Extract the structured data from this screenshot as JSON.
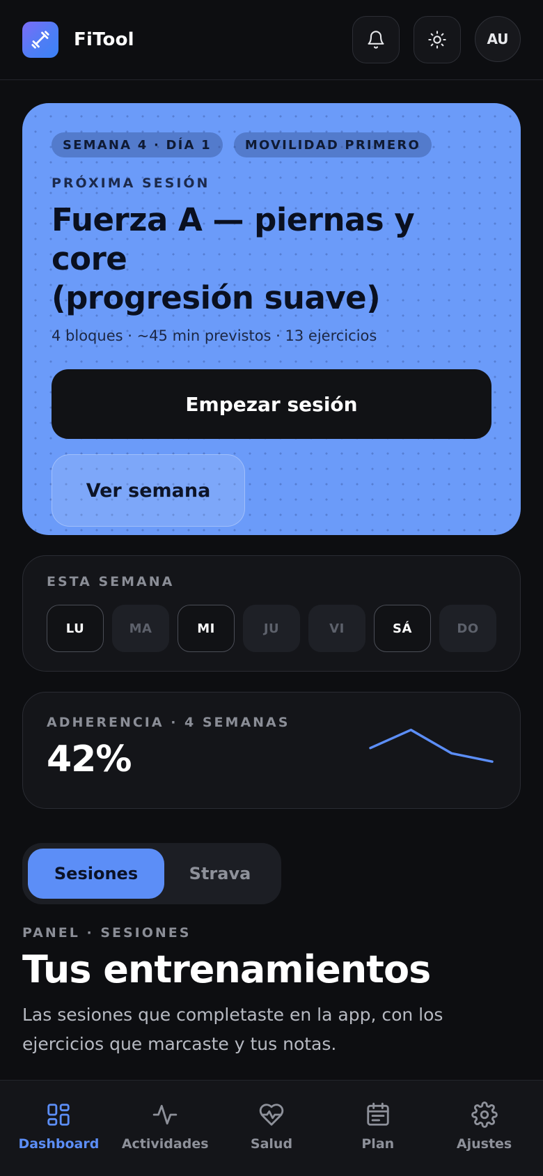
{
  "app": {
    "name": "FiTool"
  },
  "header": {
    "avatar_initials": "AU"
  },
  "hero": {
    "chips": [
      "SEMANA 4 · DÍA 1",
      "MOVILIDAD PRIMERO"
    ],
    "eyebrow": "PRÓXIMA SESIÓN",
    "title_line1": "Fuerza A — piernas y core",
    "title_line2": "(progresión suave)",
    "meta": "4 bloques · ~45 min previstos · 13 ejercicios",
    "primary_label": "Empezar sesión",
    "secondary_label": "Ver semana"
  },
  "week": {
    "label": "ESTA SEMANA",
    "days": [
      {
        "label": "LU",
        "active": true
      },
      {
        "label": "MA",
        "active": false
      },
      {
        "label": "MI",
        "active": true
      },
      {
        "label": "JU",
        "active": false
      },
      {
        "label": "VI",
        "active": false
      },
      {
        "label": "SÁ",
        "active": true
      },
      {
        "label": "DO",
        "active": false
      }
    ]
  },
  "adherence": {
    "label": "ADHERENCIA · 4 SEMANAS",
    "value": "42%",
    "trend": [
      48,
      72,
      41,
      30
    ],
    "color": "#5c8ef7"
  },
  "tabs": {
    "sessions": "Sesiones",
    "strava": "Strava",
    "selected": "sessions"
  },
  "section": {
    "eyebrow": "PANEL · SESIONES",
    "title": "Tus entrenamientos",
    "description": "Las sesiones que completaste en la app, con los ejercicios que marcaste y tus notas."
  },
  "nav": {
    "items": [
      {
        "label": "Dashboard",
        "icon": "dashboard-icon",
        "active": true
      },
      {
        "label": "Actividades",
        "icon": "activity-icon",
        "active": false
      },
      {
        "label": "Salud",
        "icon": "heart-pulse-icon",
        "active": false
      },
      {
        "label": "Plan",
        "icon": "calendar-icon",
        "active": false
      },
      {
        "label": "Ajustes",
        "icon": "gear-icon",
        "active": false
      }
    ]
  },
  "colors": {
    "accent": "#5c8ef7",
    "hero_bg": "#6b9bf9",
    "background": "#0d0e11"
  }
}
